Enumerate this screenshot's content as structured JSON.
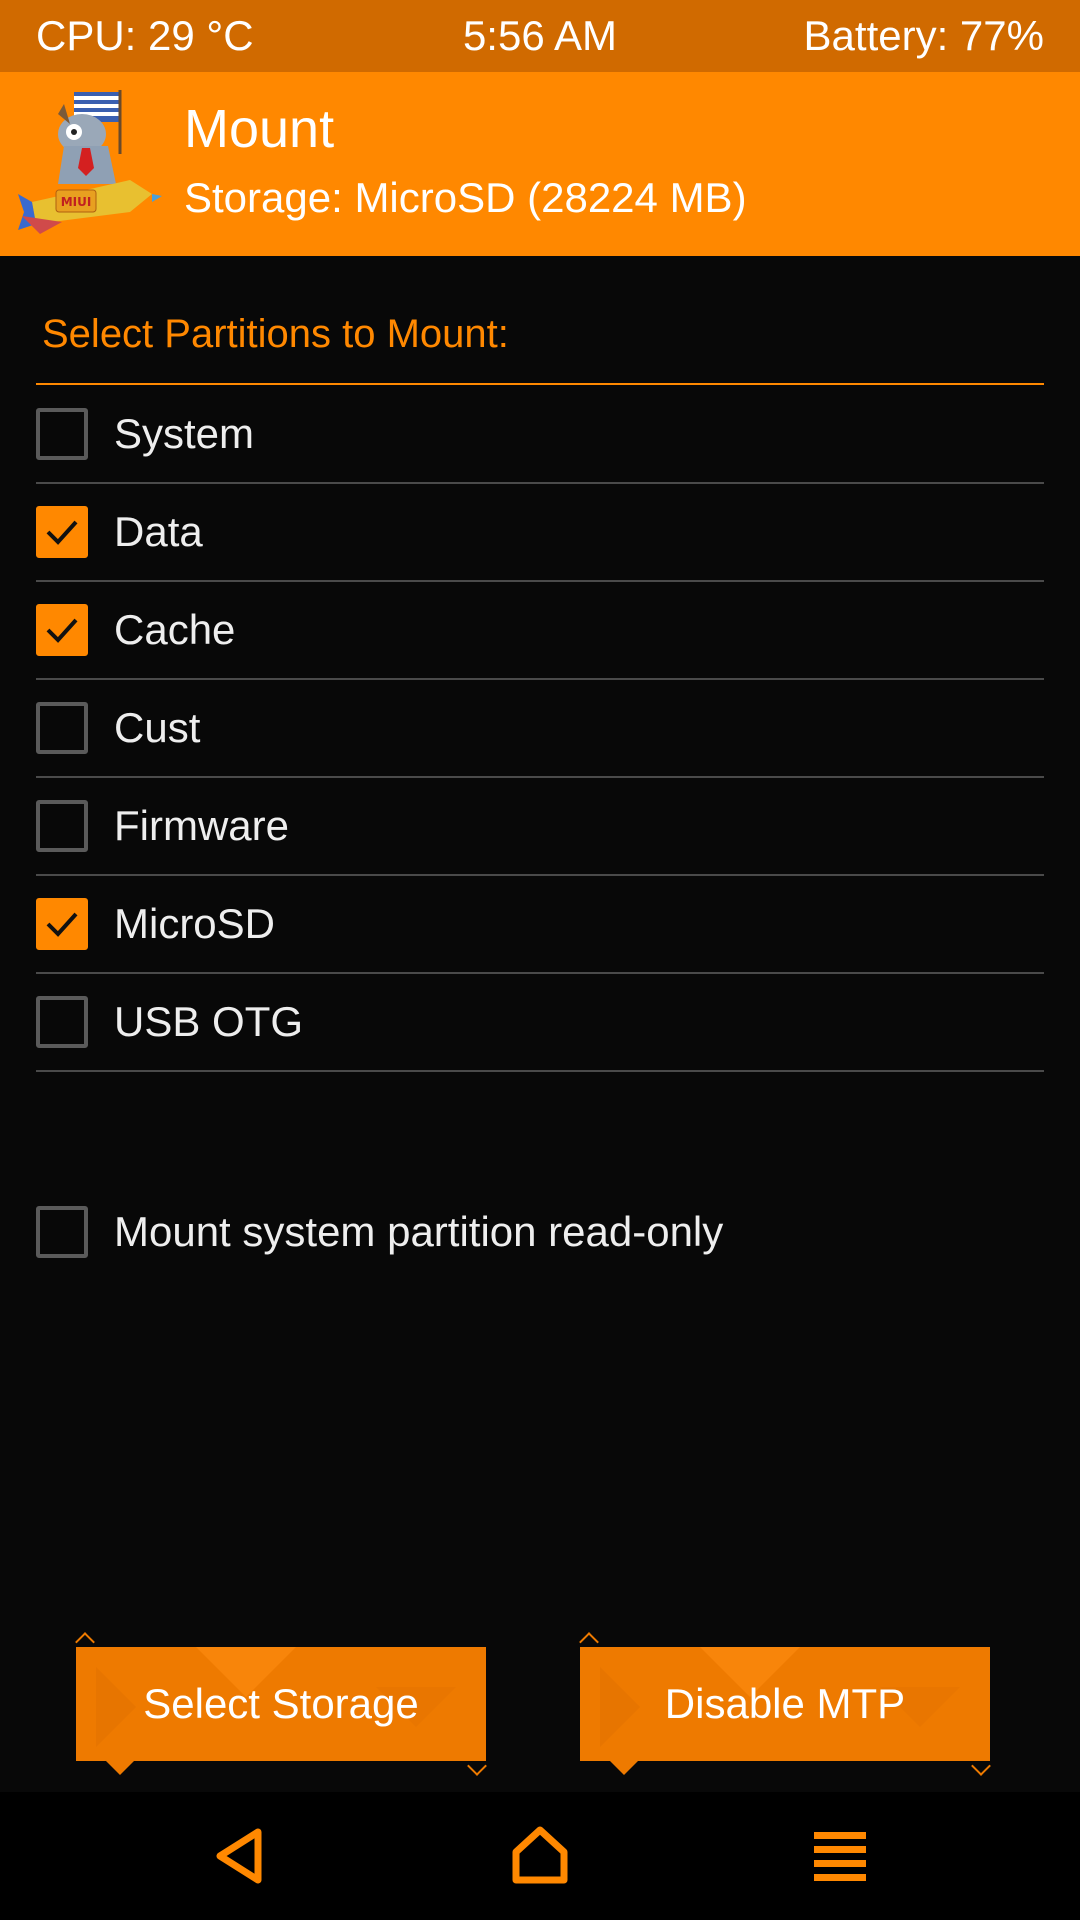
{
  "status_bar": {
    "cpu": "CPU: 29 °C",
    "time": "5:56 AM",
    "battery": "Battery: 77%"
  },
  "header": {
    "logo_icon": "miui-mascot-rocket-logo",
    "logo_text": "MIUI",
    "title": "Mount",
    "subtitle": "Storage: MicroSD (28224 MB)"
  },
  "partitions": {
    "title": "Select Partitions to Mount:",
    "items": [
      {
        "label": "System",
        "checked": false
      },
      {
        "label": "Data",
        "checked": true
      },
      {
        "label": "Cache",
        "checked": true
      },
      {
        "label": "Cust",
        "checked": false
      },
      {
        "label": "Firmware",
        "checked": false
      },
      {
        "label": "MicroSD",
        "checked": true
      },
      {
        "label": "USB OTG",
        "checked": false
      }
    ]
  },
  "readonly_option": {
    "label": "Mount system partition read-only",
    "checked": false
  },
  "buttons": {
    "select_storage": "Select Storage",
    "disable_mtp": "Disable MTP"
  },
  "nav": {
    "back_icon": "back-triangle-icon",
    "home_icon": "home-icon",
    "menu_icon": "menu-lines-icon"
  },
  "colors": {
    "accent": "#ff8800",
    "status_bar": "#d06a00",
    "background": "#080808",
    "button": "#ee7a00"
  }
}
